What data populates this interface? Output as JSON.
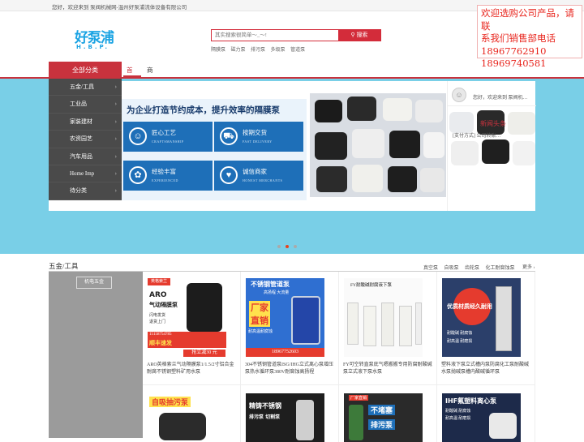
{
  "topbar": {
    "greeting": "您好，欢迎来到 泵阀机械网-温州好泵浦流体设备有限公司"
  },
  "promo": {
    "lines": [
      "欢迎选购公司产品，请联",
      "系我们销售部电话",
      "18967762910",
      "18969740581"
    ]
  },
  "logo": {
    "main": "好泵浦",
    "sub": "H.B.P."
  },
  "search": {
    "placeholder": "其实搜索很简单～_～!",
    "button": "搜索"
  },
  "hotwords": [
    "隔膜泵",
    "磁力泵",
    "排污泵",
    "多级泵",
    "管道泵"
  ],
  "nav": {
    "all_categories": "全部分类",
    "home": "首页",
    "products": "商品分类"
  },
  "categories": [
    "五金/工具",
    "工业品",
    "家装建材",
    "农资园艺",
    "汽车用品",
    "Home Imp",
    "待分类"
  ],
  "banner": {
    "slogan": "为企业打造节约成本，提升效率的隔膜泵",
    "tiles": [
      {
        "cn": "匠心工艺",
        "en": "CRAFTSMANSHIP",
        "icon": "☺"
      },
      {
        "cn": "按期交货",
        "en": "FAST DELIVERY",
        "icon": "⛟"
      },
      {
        "cn": "经验丰富",
        "en": "EXPERIENCED",
        "icon": "✿"
      },
      {
        "cn": "诚信商家",
        "en": "HONEST MERCHANTS",
        "icon": "♥"
      }
    ]
  },
  "news": {
    "hello": "您好，欢迎来到 泵阀机…",
    "headline": "新闻头条",
    "item": "[支付方式] 公司转账…"
  },
  "section": {
    "title": "五金/工具",
    "tags": [
      "真空泵",
      "自吸泵",
      "齿轮泵",
      "化工耐腐蚀泵"
    ],
    "more": "更多",
    "side_tag": "机电五金"
  },
  "products": [
    {
      "caption": "ARO英格索兰气动隔膜泵1/1.5/2寸铝合金耐腐不锈钢塑料矿用水泵",
      "img_lines": [
        "英格索兰",
        "ARO",
        "气动隔膜泵",
        "闪电发货",
        "退货上门",
        "15158754785",
        "顺丰速发",
        "抢立减30 元"
      ]
    },
    {
      "caption": "304不锈钢管道泵ISG/IHG立式离心泵增压泵热水循环泵380V耐腐蚀高扬程",
      "img_lines": [
        "不锈钢管道泵",
        "高扬程  大流量",
        "厂家",
        "直销",
        "耐高温耐腐蚀",
        "18967752603"
      ]
    },
    {
      "caption": "FY可空转直泵底气嗯搬搬专用防腐耐酸碱泵立式液下泵水泵",
      "img_lines": [
        "FY耐酸碱耐腐液下泵"
      ]
    },
    {
      "caption": "塑料液下泵立式槽内泵防腐化工泵耐酸碱水泵抛碱泵槽内酸碱循环泵",
      "img_lines": [
        "优质材质经久耐用",
        "耐酸碱 耐腐蚀",
        "耐高温 耐磨损"
      ]
    }
  ],
  "products_row2": [
    {
      "img_lines": [
        "自吸抽污泵"
      ]
    },
    {
      "img_lines": [
        "精铸不锈钢",
        "排污泵 切割泵"
      ]
    },
    {
      "img_lines": [
        "厂家直销",
        "不堵塞",
        "排污泵"
      ]
    },
    {
      "img_lines": [
        "IHF氟塑料离心泵",
        "耐酸碱 耐腐蚀",
        "耐高温 耐磨损"
      ]
    }
  ]
}
